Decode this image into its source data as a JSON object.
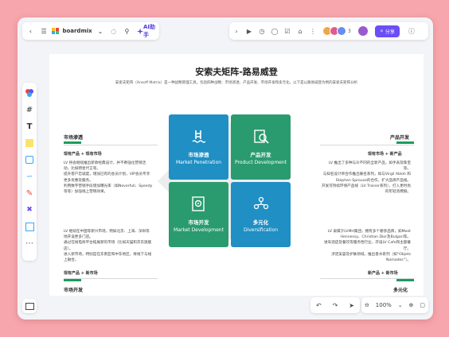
{
  "topbar": {
    "brand": "boardmix",
    "ai_label": "AI助手",
    "share_label": "分享",
    "avatar_count": "3"
  },
  "board": {
    "title": "安索夫矩阵-路易威登",
    "subtitle": "安索夫矩阵（Ansoff Matrix）是一种战略管理工具，包括四种战略：市场渗透、产品开发、市场开发和多元化。以下是以路易威登为例的安索夫矩阵分析"
  },
  "quadrants": [
    {
      "zh": "市场渗透",
      "en": "Market Penetration",
      "color": "#1f8fc4",
      "icon": "ladder-pool-icon"
    },
    {
      "zh": "产品开发",
      "en": "Product Development",
      "color": "#2a9b6f",
      "icon": "search-document-icon"
    },
    {
      "zh": "市场开发",
      "en": "Market Development",
      "color": "#2a9b6f",
      "icon": "gear-document-icon"
    },
    {
      "zh": "多元化",
      "en": "Diversification",
      "color": "#1f8fc4",
      "icon": "network-people-icon"
    }
  ],
  "sections": {
    "top_left": {
      "head": "市场渗透",
      "sub": "现有产品 + 现有市场",
      "lines": [
        "LV 将会继续推出新款经典设计，并不断强化营销活动，比如明星代言等。",
        "提升客户忠诚度，增加已有的会员计划，VIP会员专享更多优惠及服务。",
        "利用数字营销手段增加曝光率（如Neverfull、Speedy等等）加强线上营销效果。"
      ]
    },
    "top_right": {
      "head": "产品开发",
      "sub": "现有市场 + 新产品",
      "lines": [
        "LV 推出了多种与众不同的全新产品，如手表及珠宝等。",
        "与知名设计师合作推出联名系列，如与Virgil Abloh 和 Stephen Sprouse的合作，扩大品牌产品线。",
        "开发可持续环保产品线（LV Trainer系列），打入更时尚的年轻消费群。"
      ]
    },
    "bottom_left": {
      "head": "市场开发",
      "sub": "现有产品 + 新市场",
      "lines": [
        "LV 继续在中国等新兴市场，例如北京、上海、深圳等地开设更多门店。",
        "通过在线电商平台拓展新的市场（比如天猫和京东旗舰店）。",
        "进入新市场，特别是在东南亚和中东地区，将线下与线上融合。"
      ]
    },
    "bottom_right": {
      "head": "多元化",
      "sub": "新产品 + 新市场",
      "lines": [
        "LV 隶属于LVMH集团，拥有多个奢侈品牌，如Moet Hennessy、Christian Dior及Bulgari等。",
        "进军酒店及餐饮等服务性行业，开设LV Cafe和主题餐厅。",
        "涉足美容及护肤领域，推出香水系列（如“Objets Nomades”）。"
      ]
    }
  },
  "zoom": "100%"
}
